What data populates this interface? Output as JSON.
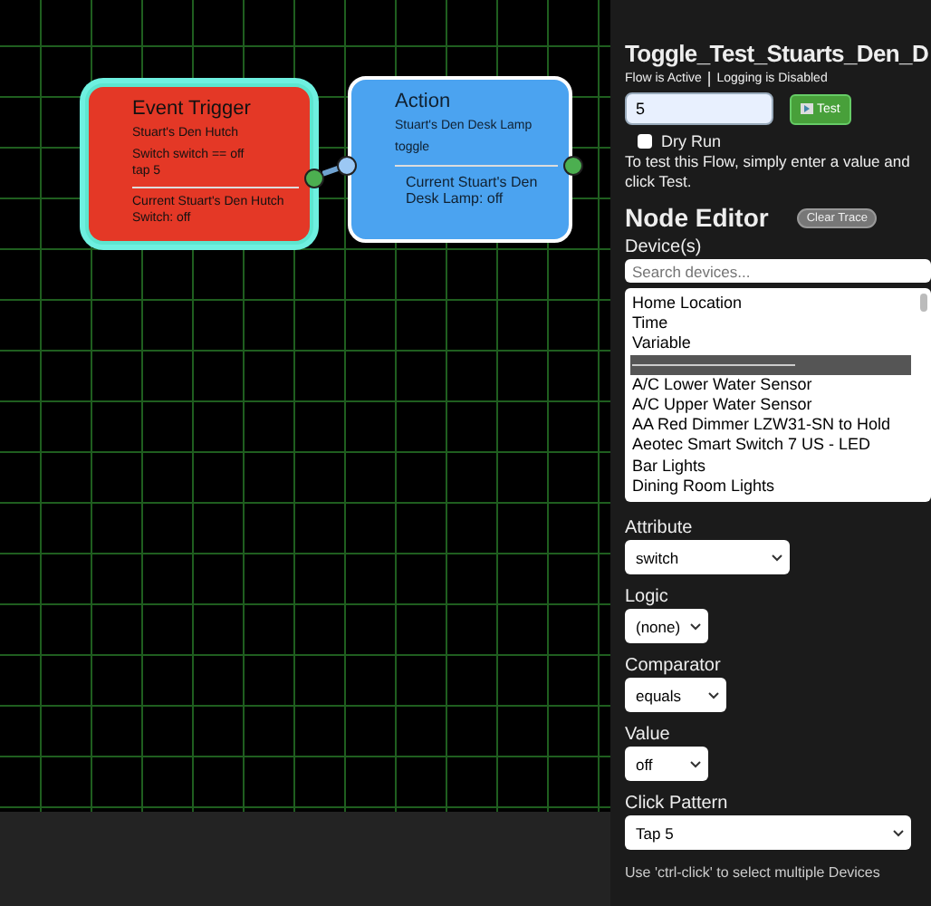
{
  "canvas": {
    "nodes": [
      {
        "kind": "trigger",
        "selected": true,
        "title": "Event Trigger",
        "lines": [
          "Stuart's Den Hutch",
          "Switch switch == off\ntap 5"
        ],
        "status": "Current Stuart's Den Hutch Switch: off"
      },
      {
        "kind": "action",
        "selected": false,
        "title": "Action",
        "lines": [
          "Stuart's Den Desk Lamp",
          "toggle"
        ],
        "status": "Current Stuart's Den Desk Lamp: off"
      }
    ]
  },
  "flow": {
    "title": "Toggle_Test_Stuarts_Den_D",
    "active_status": "Flow is Active",
    "separator": "|",
    "logging_status": "Logging is Disabled",
    "test_value": "5",
    "test_button": "Test",
    "dry_run": {
      "label": "Dry Run",
      "checked": false
    },
    "help": "To test this Flow, simply enter a value and click Test."
  },
  "node_editor": {
    "heading": "Node Editor",
    "clear_button": "Clear Trace",
    "devices_label": "Device(s)",
    "search_placeholder": "Search devices...",
    "devices": [
      {
        "kind": "device",
        "label": "Home Location",
        "selected": false
      },
      {
        "kind": "device",
        "label": "Time",
        "selected": false
      },
      {
        "kind": "device",
        "label": "Variable",
        "selected": false
      },
      {
        "kind": "separator",
        "selected": true
      },
      {
        "kind": "device",
        "label": "A/C Lower Water Sensor",
        "selected": false
      },
      {
        "kind": "device",
        "label": "A/C Upper Water Sensor",
        "selected": false
      },
      {
        "kind": "device",
        "label": "AA Red Dimmer LZW31-SN to Hold",
        "selected": false
      },
      {
        "kind": "device",
        "label": "Aeotec Smart Switch 7 US - LED",
        "selected": false
      },
      {
        "kind": "device",
        "label": "Bar Lights",
        "selected": false
      },
      {
        "kind": "device",
        "label": "Dining Room Lights",
        "selected": false
      }
    ],
    "fields": [
      {
        "label": "Attribute",
        "value": "switch"
      },
      {
        "label": "Logic",
        "value": "(none)"
      },
      {
        "label": "Comparator",
        "value": "equals"
      },
      {
        "label": "Value",
        "value": "off"
      },
      {
        "label": "Click Pattern",
        "value": "Tap 5"
      }
    ],
    "hint": "Use 'ctrl-click' to select multiple Devices"
  }
}
